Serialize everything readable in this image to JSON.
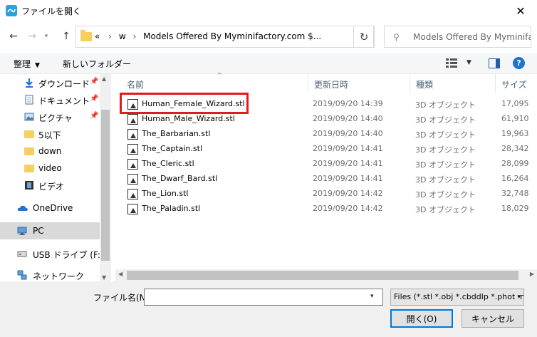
{
  "window": {
    "title": "ファイルを開く",
    "close_glyph": "✕"
  },
  "address": {
    "overflow": "«",
    "segments": [
      "w",
      "Models Offered By Myminifactory.com $..."
    ],
    "separator": "›"
  },
  "search": {
    "placeholder": "Models Offered By Myminifa..."
  },
  "toolbar": {
    "organize": "整理",
    "new_folder": "新しいフォルダー",
    "help": "?"
  },
  "nav": {
    "items": [
      {
        "label": "ダウンロード",
        "icon": "download-arrow-icon",
        "pinned": true
      },
      {
        "label": "ドキュメント",
        "icon": "document-icon",
        "pinned": true
      },
      {
        "label": "ピクチャ",
        "icon": "picture-icon",
        "pinned": true
      },
      {
        "label": "5以下",
        "icon": "folder-icon",
        "pinned": false
      },
      {
        "label": "down",
        "icon": "folder-icon",
        "pinned": false
      },
      {
        "label": "video",
        "icon": "folder-icon",
        "pinned": false
      },
      {
        "label": "ビデオ",
        "icon": "video-icon",
        "pinned": false
      },
      {
        "label": "OneDrive",
        "icon": "cloud-icon",
        "pinned": false
      },
      {
        "label": "PC",
        "icon": "pc-icon",
        "pinned": false,
        "selected": true
      },
      {
        "label": "USB ドライブ (F:)",
        "icon": "usb-drive-icon",
        "pinned": false
      },
      {
        "label": "ネットワーク",
        "icon": "network-icon",
        "pinned": false
      }
    ]
  },
  "columns": {
    "name": "名前",
    "date": "更新日時",
    "type": "種類",
    "size": "サイズ"
  },
  "files": [
    {
      "name": "Human_Female_Wizard.stl",
      "date": "2019/09/20 14:39",
      "type": "3D オブジェクト",
      "size": "17,095"
    },
    {
      "name": "Human_Male_Wizard.stl",
      "date": "2019/09/20 14:40",
      "type": "3D オブジェクト",
      "size": "61,910"
    },
    {
      "name": "The_Barbarian.stl",
      "date": "2019/09/20 14:40",
      "type": "3D オブジェクト",
      "size": "19,963"
    },
    {
      "name": "The_Captain.stl",
      "date": "2019/09/20 14:41",
      "type": "3D オブジェクト",
      "size": "28,342"
    },
    {
      "name": "The_Cleric.stl",
      "date": "2019/09/20 14:41",
      "type": "3D オブジェクト",
      "size": "28,099"
    },
    {
      "name": "The_Dwarf_Bard.stl",
      "date": "2019/09/20 14:41",
      "type": "3D オブジェクト",
      "size": "16,264"
    },
    {
      "name": "The_Lion.stl",
      "date": "2019/09/20 14:42",
      "type": "3D オブジェクト",
      "size": "32,748"
    },
    {
      "name": "The_Paladin.stl",
      "date": "2019/09/20 14:42",
      "type": "3D オブジェクト",
      "size": "18,029"
    }
  ],
  "bottom": {
    "filename_label": "ファイル名(N):",
    "filename_value": "",
    "filter": "Files (*.stl *.obj *.cbddlp *.photon *.ctb)",
    "open": "開く(O)",
    "cancel": "キャンセル"
  },
  "colors": {
    "accent": "#0078d7",
    "highlight": "#e01c1c",
    "folder": "#f6cf60"
  }
}
